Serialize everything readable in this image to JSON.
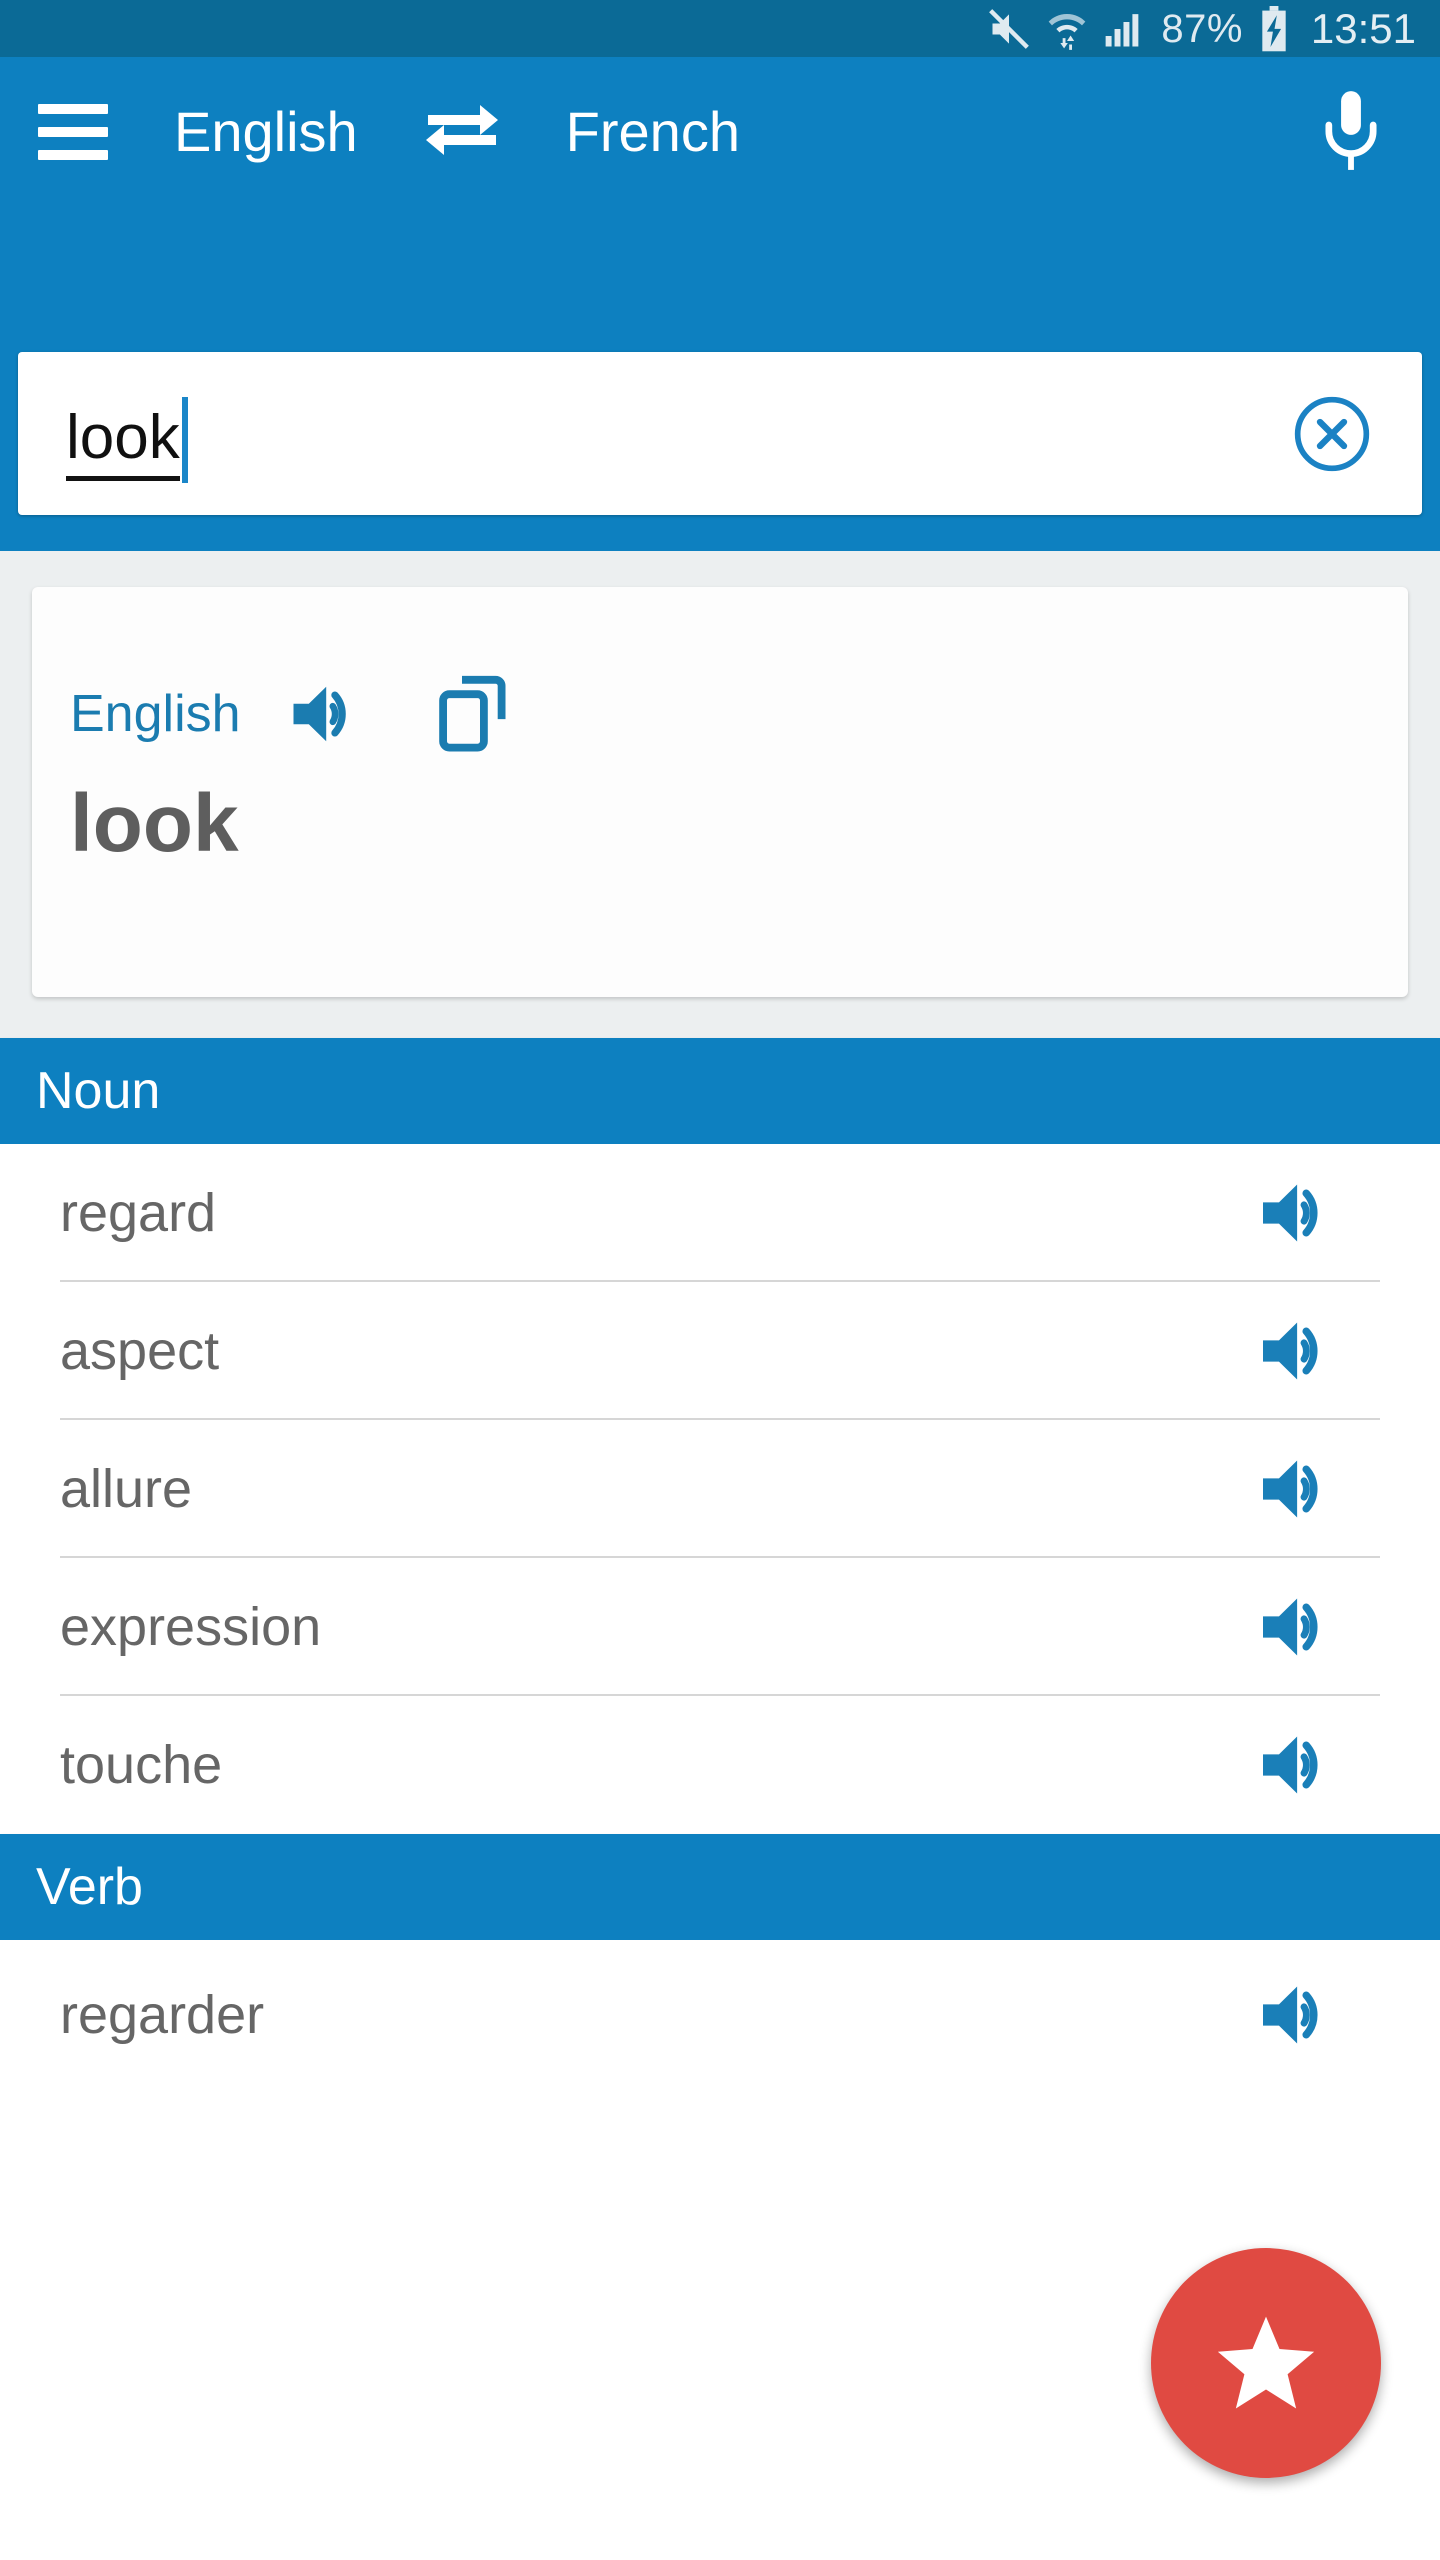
{
  "status_bar": {
    "battery_percent": "87%",
    "clock": "13:51",
    "icons": [
      "mute-icon",
      "wifi-transfer-icon",
      "cellular-signal-icon",
      "battery-charging-icon"
    ],
    "background_color": "#0b6a96"
  },
  "app_bar": {
    "background_color": "#0d80c0",
    "menu_icon": "hamburger-menu-icon",
    "source_language": "English",
    "swap_icon": "swap-arrows-icon",
    "target_language": "French",
    "mic_icon": "microphone-icon"
  },
  "search": {
    "value": "look",
    "placeholder": "",
    "clear_icon": "clear-circle-icon"
  },
  "headword_card": {
    "language_label": "English",
    "speak_icon": "speaker-icon",
    "copy_icon": "copy-icon",
    "word": "look",
    "accent_color": "#1b7cb0",
    "word_color": "#5e5e5e"
  },
  "sections": [
    {
      "title": "Noun",
      "entries": [
        {
          "word": "regard",
          "speak_icon": "speaker-icon"
        },
        {
          "word": "aspect",
          "speak_icon": "speaker-icon"
        },
        {
          "word": "allure",
          "speak_icon": "speaker-icon"
        },
        {
          "word": "expression",
          "speak_icon": "speaker-icon"
        },
        {
          "word": "touche",
          "speak_icon": "speaker-icon"
        }
      ]
    },
    {
      "title": "Verb",
      "entries": [
        {
          "word": "regarder",
          "speak_icon": "speaker-icon"
        }
      ]
    }
  ],
  "fab": {
    "icon": "star-icon",
    "color": "#e04a42"
  }
}
